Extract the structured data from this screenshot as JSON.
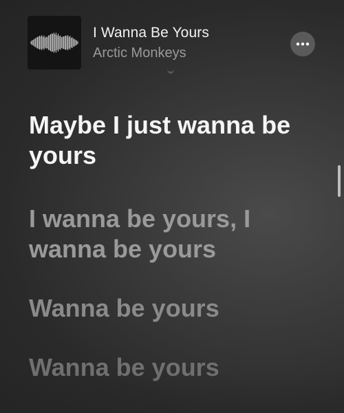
{
  "now_playing": {
    "title": "I Wanna Be Yours",
    "artist": "Arctic Monkeys",
    "artwork_icon": "soundwave-artwork",
    "more_icon": "ellipsis-icon"
  },
  "lyrics": {
    "lines": [
      {
        "text": "Maybe I just wanna be yours",
        "state": "active"
      },
      {
        "text": "I wanna be yours, I wanna be yours",
        "state": "upcoming"
      },
      {
        "text": "Wanna be yours",
        "state": "upcoming"
      },
      {
        "text": "Wanna be yours",
        "state": "upcoming"
      }
    ]
  },
  "colors": {
    "background": "#2a2a2a",
    "active_lyric": "#f5f5f5",
    "upcoming_lyric": "#9a9a9a",
    "artist_text": "#9a9a9a"
  }
}
